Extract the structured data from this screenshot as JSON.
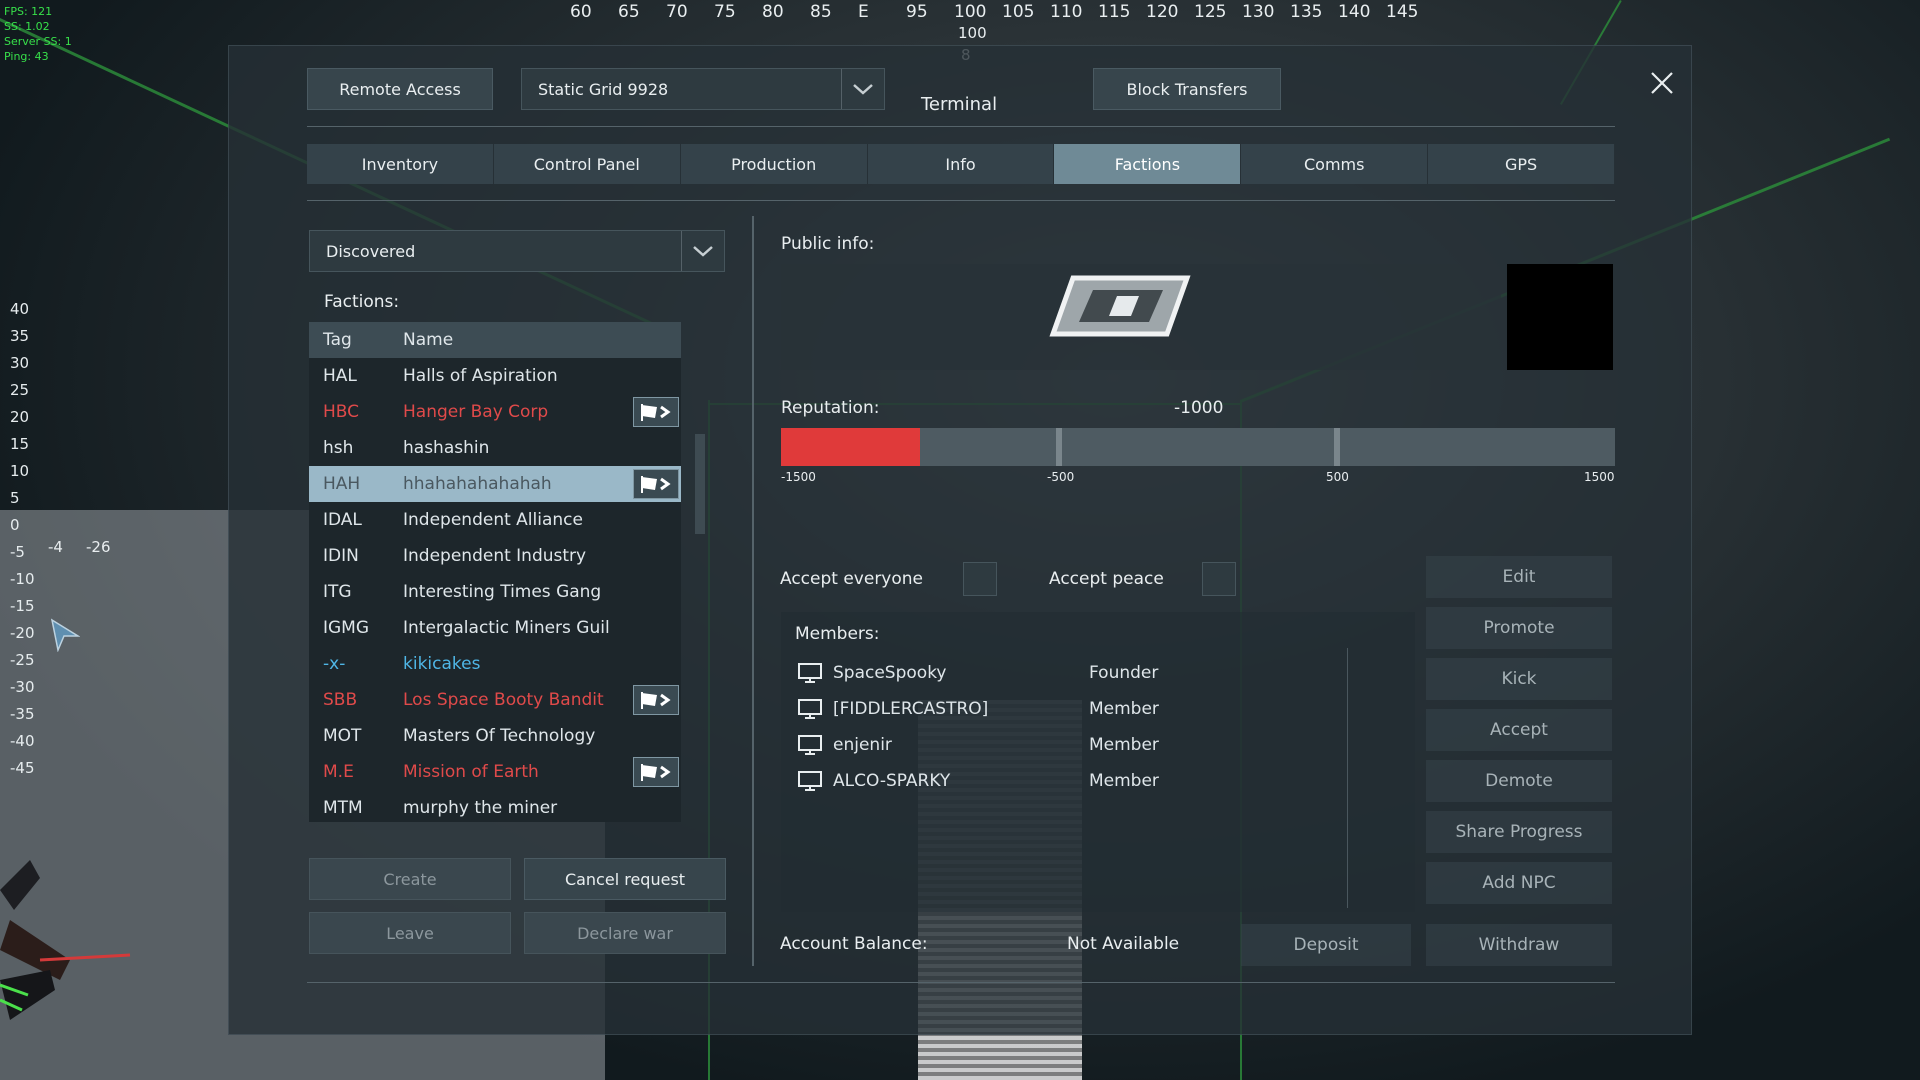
{
  "hud": {
    "stats": [
      "FPS: 121",
      "SS: 1.02",
      "Server SS: 1",
      "Ping: 43"
    ],
    "compass": [
      "60",
      "65",
      "70",
      "75",
      "80",
      "85",
      "E",
      "95",
      "100",
      "105",
      "110",
      "115",
      "120",
      "125",
      "130",
      "135",
      "140",
      "145"
    ],
    "compass_sub": [
      "100",
      "8"
    ],
    "pitch_scale": [
      "40",
      "35",
      "30",
      "25",
      "20",
      "15",
      "10",
      "5",
      "0",
      "-5",
      "-10",
      "-15",
      "-20",
      "-25",
      "-30",
      "-35",
      "-40",
      "-45"
    ],
    "pitch_extra": [
      "-4",
      "-26"
    ]
  },
  "terminal": {
    "title": "Terminal",
    "remote_access": "Remote Access",
    "grid_selected": "Static Grid 9928",
    "block_transfers": "Block Transfers",
    "tabs": [
      "Inventory",
      "Control Panel",
      "Production",
      "Info",
      "Factions",
      "Comms",
      "GPS"
    ],
    "active_tab": "Factions"
  },
  "factions": {
    "filter": "Discovered",
    "label": "Factions:",
    "columns": {
      "tag": "Tag",
      "name": "Name"
    },
    "rows": [
      {
        "tag": "HAL",
        "name": "Halls of Aspiration",
        "color": "white",
        "flag": false
      },
      {
        "tag": "HBC",
        "name": "Hanger Bay Corp",
        "color": "red",
        "flag": true
      },
      {
        "tag": "hsh",
        "name": "hashashin",
        "color": "white",
        "flag": false
      },
      {
        "tag": "HAH",
        "name": "hhahahahahahah",
        "color": "selected",
        "flag": true
      },
      {
        "tag": "IDAL",
        "name": "Independent Alliance",
        "color": "white",
        "flag": false
      },
      {
        "tag": "IDIN",
        "name": "Independent Industry",
        "color": "white",
        "flag": false
      },
      {
        "tag": "ITG",
        "name": "Interesting Times Gang",
        "color": "white",
        "flag": false
      },
      {
        "tag": "IGMG",
        "name": "Intergalactic Miners Guil",
        "color": "white",
        "flag": false
      },
      {
        "tag": "-x-",
        "name": "kikicakes",
        "color": "blue",
        "flag": false
      },
      {
        "tag": "SBB",
        "name": "Los Space Booty Bandit",
        "color": "red",
        "flag": true
      },
      {
        "tag": "MOT",
        "name": "Masters Of Technology",
        "color": "white",
        "flag": false
      },
      {
        "tag": "M.E",
        "name": "Mission of Earth",
        "color": "red",
        "flag": true
      },
      {
        "tag": "MTM",
        "name": "murphy the miner",
        "color": "white",
        "flag": false
      }
    ],
    "buttons": {
      "create": "Create",
      "cancel_request": "Cancel request",
      "leave": "Leave",
      "declare_war": "Declare war"
    }
  },
  "details": {
    "public_info_label": "Public info:",
    "reputation_label": "Reputation:",
    "reputation_value": "-1000",
    "reputation_numeric": -1000,
    "rep_min": -1500,
    "rep_max": 1500,
    "rep_scale": [
      "-1500",
      "-500",
      "500",
      "1500"
    ],
    "accept_everyone": "Accept everyone",
    "accept_peace": "Accept peace",
    "members_label": "Members:",
    "members": [
      {
        "name": "SpaceSpooky",
        "rank": "Founder"
      },
      {
        "name": "[FIDDLERCASTRO]",
        "rank": "Member"
      },
      {
        "name": "enjenir",
        "rank": "Member"
      },
      {
        "name": "ALCO-SPARKY",
        "rank": "Member"
      }
    ],
    "side_buttons": [
      "Edit",
      "Promote",
      "Kick",
      "Accept",
      "Demote",
      "Share Progress",
      "Add NPC"
    ],
    "account_balance_label": "Account Balance:",
    "account_balance_value": "Not Available",
    "deposit": "Deposit",
    "withdraw": "Withdraw"
  },
  "colors": {
    "accent_red": "#e03a3a",
    "selected_row": "#9ab8c8",
    "active_tab": "#6f8a96",
    "hud_green": "#37e04a"
  }
}
